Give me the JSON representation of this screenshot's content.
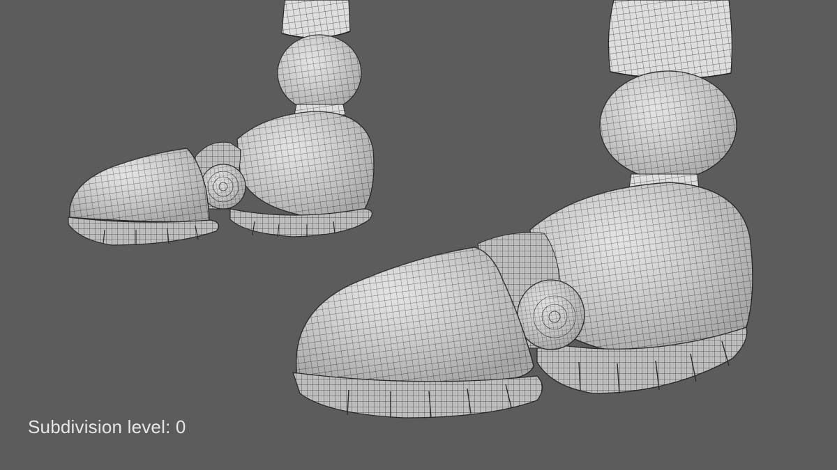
{
  "viewport": {
    "overlay_text": "Subdivision level: 0",
    "colors": {
      "background": "#5c5c5c",
      "mesh_fill": "#dcdcdc",
      "mesh_shade": "#b8b8b8",
      "wire": "#2a2a2a",
      "overlay_text": "#e6e6e6"
    }
  },
  "scene": {
    "objects": [
      {
        "name": "left-foot-model",
        "parts": [
          "leg-shin",
          "ankle-ball",
          "heel-shell",
          "toe-cap",
          "joint-disc",
          "sole-pads"
        ]
      },
      {
        "name": "right-foot-model",
        "parts": [
          "leg-shin",
          "ankle-ball",
          "heel-shell",
          "toe-cap",
          "joint-disc",
          "sole-pads"
        ]
      }
    ]
  }
}
